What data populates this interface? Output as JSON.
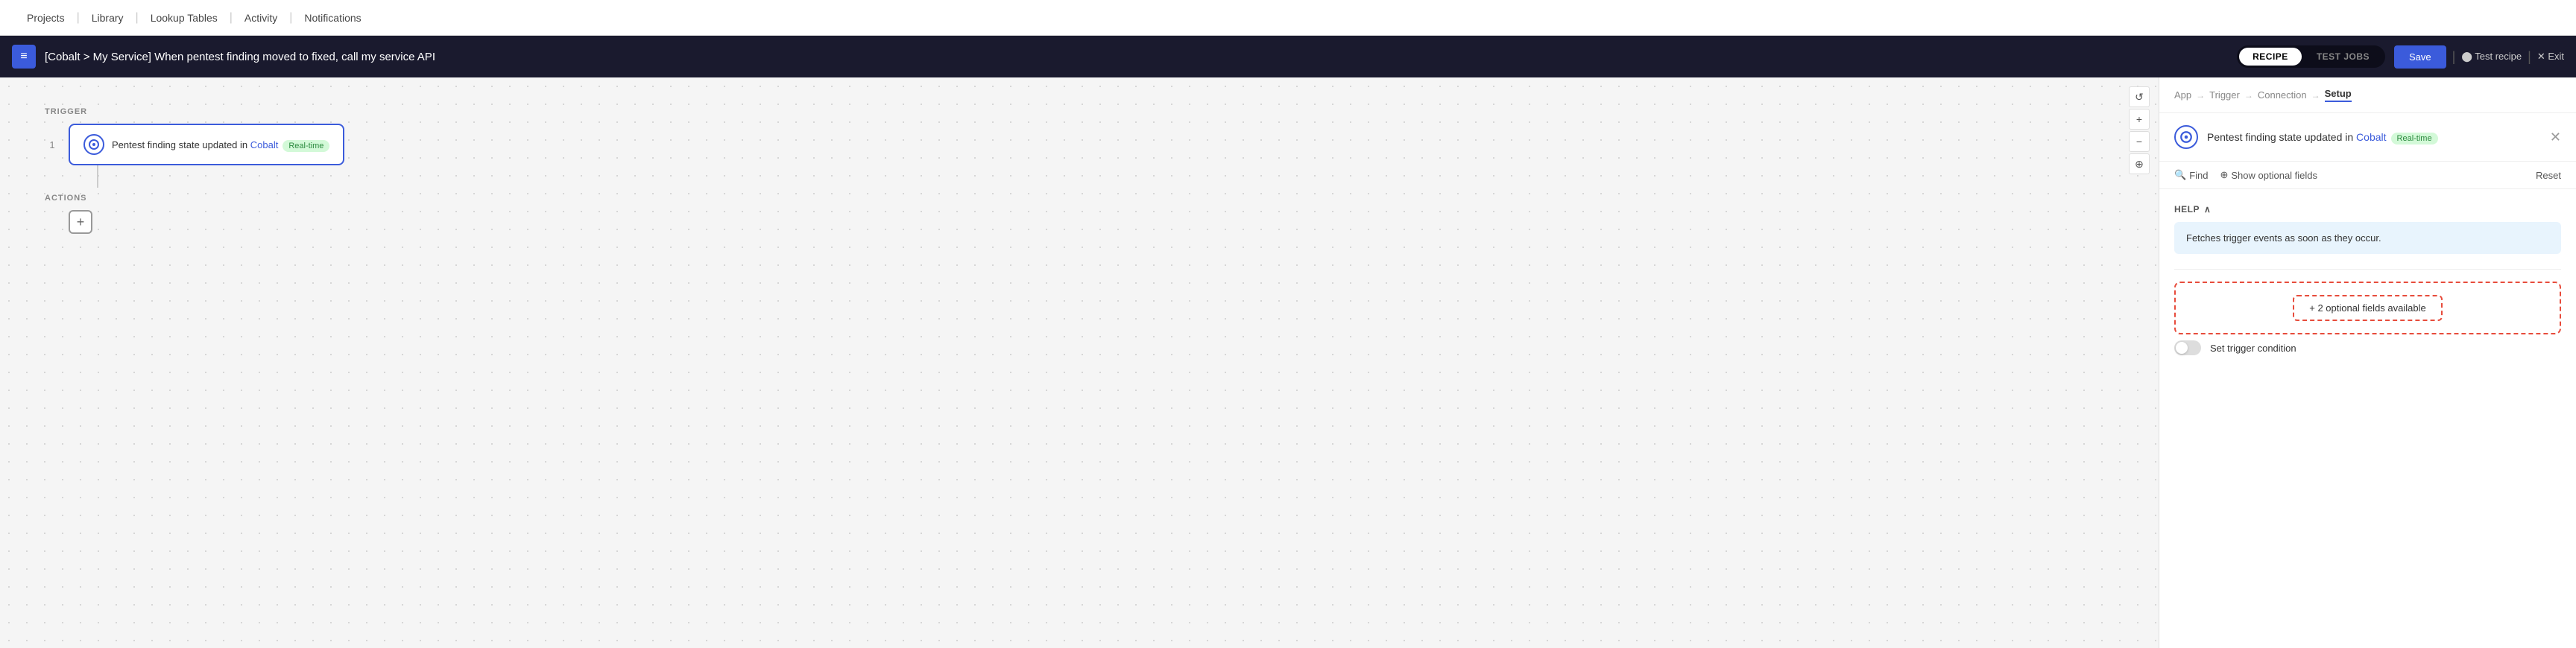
{
  "nav": {
    "items": [
      {
        "label": "Projects",
        "id": "projects"
      },
      {
        "label": "Library",
        "id": "library"
      },
      {
        "label": "Lookup Tables",
        "id": "lookup-tables"
      },
      {
        "label": "Activity",
        "id": "activity"
      },
      {
        "label": "Notifications",
        "id": "notifications"
      }
    ]
  },
  "recipe_bar": {
    "icon": "≡",
    "title": "[Cobalt > My Service] When pentest finding moved to fixed, call my service API",
    "toggle": {
      "recipe_label": "RECIPE",
      "test_jobs_label": "TEST JOBS",
      "active": "recipe"
    },
    "save_label": "Save",
    "test_recipe_label": "⬤ Test recipe",
    "exit_label": "✕ Exit"
  },
  "canvas": {
    "trigger_label": "TRIGGER",
    "actions_label": "ACTIONS",
    "node_number": "1",
    "trigger_node": {
      "text_prefix": "Pentest finding state updated in ",
      "link_text": "Cobalt",
      "badge": "Real-time"
    },
    "add_icon": "+",
    "controls": {
      "refresh": "↺",
      "plus": "+",
      "minus": "−",
      "target": "⊕"
    }
  },
  "right_panel": {
    "breadcrumbs": [
      {
        "label": "App",
        "active": false
      },
      {
        "label": "Trigger",
        "active": false
      },
      {
        "label": "Connection",
        "active": false
      },
      {
        "label": "Setup",
        "active": true
      }
    ],
    "header": {
      "title_prefix": "Pentest finding state updated in ",
      "link_text": "Cobalt",
      "badge": "Real-time",
      "close_icon": "✕"
    },
    "toolbar": {
      "find_label": "Find",
      "show_optional_label": "Show optional fields",
      "reset_label": "Reset"
    },
    "help": {
      "section_label": "HELP",
      "collapse_icon": "∧",
      "body_text": "Fetches trigger events as soon as they occur."
    },
    "optional_fields": {
      "button_label": "+ 2 optional fields available"
    },
    "set_trigger_condition": {
      "label": "Set trigger condition"
    }
  }
}
